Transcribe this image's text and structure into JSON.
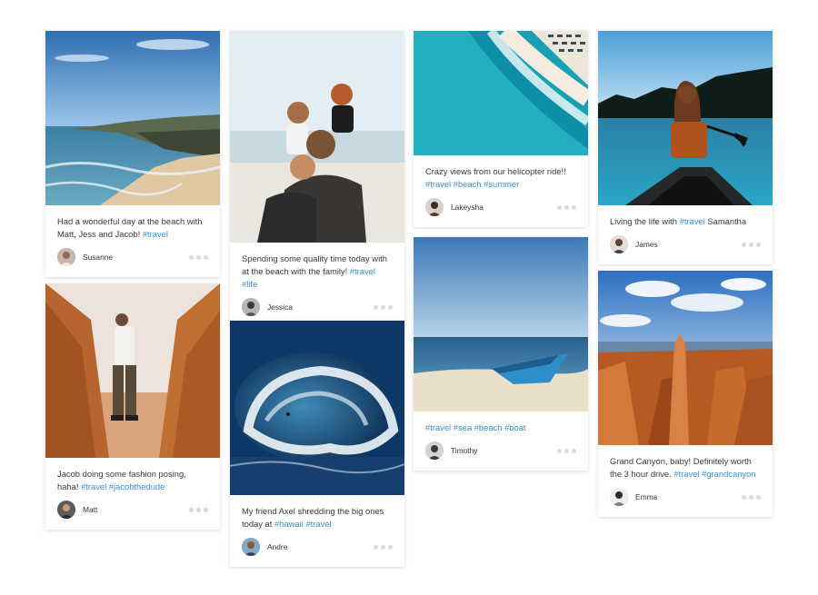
{
  "posts": [
    {
      "photo": "beach-coast-photo",
      "caption": "Had a wonderful day at the beach with Matt, Jess and Jacob!",
      "tags": [
        "#travel"
      ],
      "author": "Susanne",
      "avatar": "susanne-avatar"
    },
    {
      "photo": "family-beach-photo",
      "caption": "Spending some quality time today with at the beach with the family!",
      "tags": [
        "#travel",
        "#life"
      ],
      "author": "Jessica",
      "avatar": "jessica-avatar"
    },
    {
      "photo": "helicopter-ocean-photo",
      "caption": "Crazy views from our helicopter ride!!",
      "tags": [
        "#travel",
        "#beach",
        "#summer"
      ],
      "author": "Lakeysha",
      "avatar": "lakeysha-avatar"
    },
    {
      "photo": "canoe-lake-photo",
      "caption": "Living the life with",
      "tags": [
        "#travel"
      ],
      "caption_after": "Samantha",
      "author": "James",
      "avatar": "james-avatar"
    },
    {
      "photo": "fashion-pose-photo",
      "caption": "Jacob doing some fashion posing, haha!",
      "tags": [
        "#travel",
        "#jacobthedude"
      ],
      "author": "Matt",
      "avatar": "matt-avatar"
    },
    {
      "photo": "surf-wave-photo",
      "caption": "My friend Axel shredding the big ones today at",
      "tags": [
        "#hawaii",
        "#travel"
      ],
      "author": "Andre",
      "avatar": "andre-avatar"
    },
    {
      "photo": "boat-beach-photo",
      "caption": "",
      "tags": [
        "#travel",
        "#sea",
        "#beach",
        "#boat"
      ],
      "author": "Timothy",
      "avatar": "timothy-avatar"
    },
    {
      "photo": "grand-canyon-photo",
      "caption": "Grand Canyon, baby! Definitely worth the 3 hour drive.",
      "tags": [
        "#travel",
        "#grandcanyon"
      ],
      "author": "Emma",
      "avatar": "emma-avatar"
    }
  ],
  "colors": {
    "hashtag": "#3b8fd0",
    "dots": "#dadada"
  }
}
